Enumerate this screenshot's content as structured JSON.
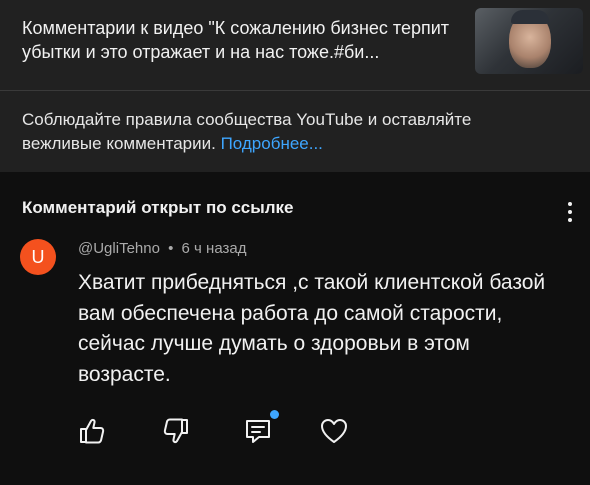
{
  "video": {
    "title": "Комментарии к видео \"К сожалению бизнес терпит убытки и это отражает и на нас тоже.#би..."
  },
  "rules": {
    "text": "Соблюдайте правила сообщества YouTube и оставляйте вежливые комментарии. ",
    "more_link": "Подробнее..."
  },
  "section": {
    "title": "Комментарий открыт по ссылке"
  },
  "comment": {
    "avatar_letter": "U",
    "author": "@UgliTehno",
    "separator": "•",
    "time": "6 ч назад",
    "text": "Хватит прибедняться ,с такой клиентской базой вам обеспечена работа до самой старости, сейчас лучше думать о здоровьи в этом возрасте."
  },
  "actions": {
    "icons": [
      "thumbs-up-icon",
      "thumbs-down-icon",
      "reply-icon",
      "heart-icon"
    ]
  },
  "colors": {
    "background": "#0f0f0f",
    "header_bg": "#212121",
    "link": "#3ea6ff",
    "avatar": "#f4511e",
    "secondary_text": "#aaaaaa"
  }
}
